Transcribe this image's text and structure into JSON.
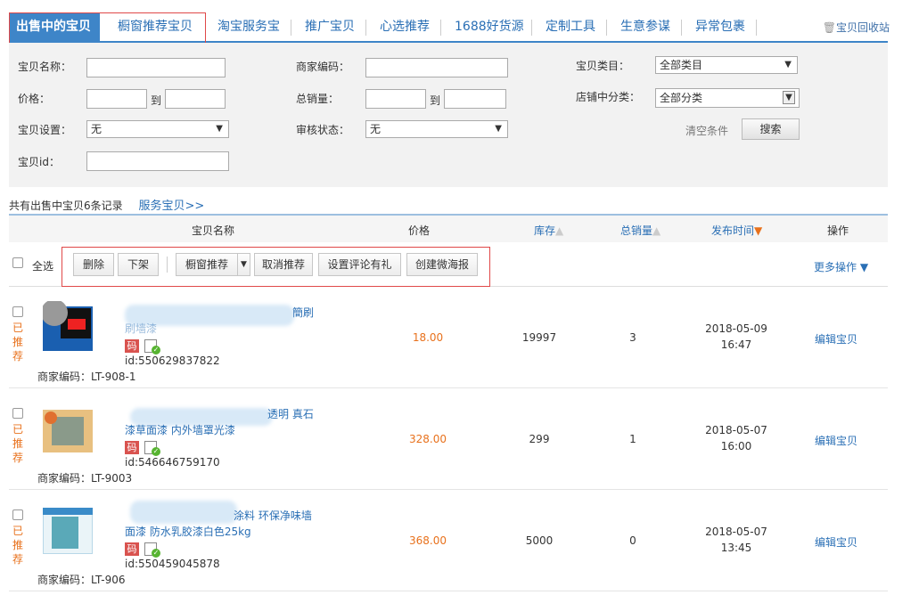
{
  "tabs": [
    {
      "label": "出售中的宝贝"
    },
    {
      "label": "橱窗推荐宝贝"
    },
    {
      "label": "淘宝服务宝"
    },
    {
      "label": "推广宝贝"
    },
    {
      "label": "心选推荐"
    },
    {
      "label": "1688好货源"
    },
    {
      "label": "定制工具"
    },
    {
      "label": "生意参谋"
    },
    {
      "label": "异常包裹"
    }
  ],
  "recycle_bin": "宝贝回收站",
  "filters": {
    "item_name_label": "宝贝名称：",
    "merchant_code_label": "商家编码：",
    "category_label": "宝贝类目：",
    "category_value": "全部类目",
    "price_label": "价格：",
    "to1": "到",
    "total_sales_label": "总销量：",
    "to2": "到",
    "shop_category_label": "店铺中分类：",
    "shop_category_value": "全部分类",
    "item_setting_label": "宝贝设置：",
    "item_setting_value": "无",
    "audit_label": "审核状态：",
    "audit_value": "无",
    "clear": "清空条件",
    "search": "搜索",
    "item_id_label": "宝贝id："
  },
  "summary": {
    "count_text": "共有出售中宝贝6条记录",
    "service_link": "服务宝贝>>"
  },
  "columns": {
    "name": "宝贝名称",
    "price": "价格",
    "stock": "库存",
    "sales": "总销量",
    "time": "发布时间",
    "ops": "操作"
  },
  "toolbar": {
    "select_all": "全选",
    "delete": "删除",
    "delist": "下架",
    "window_rec": "橱窗推荐",
    "cancel_rec": "取消推荐",
    "set_review": "设置评论有礼",
    "create_poster": "创建微海报",
    "more": "更多操作"
  },
  "rows": [
    {
      "rec": "已推荐",
      "title1": "簡刷",
      "title2": "刷墙漆",
      "code_badge": "码",
      "id": "id:550629837822",
      "merchant_code": "商家编码：LT-908-1",
      "price": "18.00",
      "stock": "19997",
      "sales": "3",
      "date": "2018-05-09",
      "time": "16:47",
      "edit": "编辑宝贝"
    },
    {
      "rec": "已推荐",
      "title1": "透明 真石",
      "title2": "漆草面漆 内外墙罩光漆",
      "code_badge": "码",
      "id": "id:546646759170",
      "merchant_code": "商家编码：LT-9003",
      "price": "328.00",
      "stock": "299",
      "sales": "1",
      "date": "2018-05-07",
      "time": "16:00",
      "edit": "编辑宝贝"
    },
    {
      "rec": "已推荐",
      "title1": "涂料 环保净味墙",
      "title2": "面漆 防水乳胶漆白色25kg",
      "code_badge": "码",
      "id": "id:550459045878",
      "merchant_code": "商家编码：LT-906",
      "price": "368.00",
      "stock": "5000",
      "sales": "0",
      "date": "2018-05-07",
      "time": "13:45",
      "edit": "编辑宝贝"
    }
  ],
  "colors": {
    "accent": "#3e85c8",
    "link": "#2a6fb5",
    "orange": "#e8711c",
    "highlight_box": "#e04848"
  }
}
